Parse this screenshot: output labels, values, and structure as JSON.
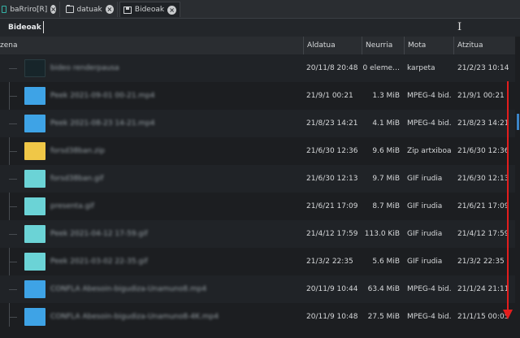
{
  "tabs": [
    {
      "label": "baRriro[R]",
      "icon": "teal-folder-icon"
    },
    {
      "label": "datuak",
      "icon": "folder-icon"
    },
    {
      "label": "Bideoak",
      "icon": "save-icon",
      "active": true
    }
  ],
  "location": {
    "crumb": "Bideoak"
  },
  "columns": {
    "name": "zena",
    "modified": "Aldatua",
    "size": "Neurria",
    "type": "Mota",
    "accessed": "Atzitua"
  },
  "files": [
    {
      "name": "bideo renderpausa",
      "thumb": "folder",
      "modified": "20/11/8 20:48",
      "size": "0 eleme…",
      "type": "karpeta",
      "accessed": "21/2/23 10:14"
    },
    {
      "name": "Peek 2021-09-01 00-21.mp4",
      "thumb": "video",
      "modified": "21/9/1 00:21",
      "size": "1.3 MiB",
      "type": "MPEG-4 bid…",
      "accessed": "21/9/1 00:21"
    },
    {
      "name": "Peek 2021-08-23 14-21.mp4",
      "thumb": "video",
      "modified": "21/8/23 14:21",
      "size": "4.1 MiB",
      "type": "MPEG-4 bid…",
      "accessed": "21/8/23 14:21"
    },
    {
      "name": "forsd38ban.zip",
      "thumb": "zip",
      "modified": "21/6/30 12:36",
      "size": "9.6 MiB",
      "type": "Zip artxiboa",
      "accessed": "21/6/30 12:36"
    },
    {
      "name": "forsd38ban.gif",
      "thumb": "gif",
      "modified": "21/6/30 12:13",
      "size": "9.7 MiB",
      "type": "GIF irudia",
      "accessed": "21/6/30 12:13"
    },
    {
      "name": "presenta.gif",
      "thumb": "gif",
      "modified": "21/6/21 17:09",
      "size": "8.7 MiB",
      "type": "GIF irudia",
      "accessed": "21/6/21 17:09"
    },
    {
      "name": "Peek 2021-04-12 17-59.gif",
      "thumb": "gif",
      "modified": "21/4/12 17:59",
      "size": "113.0 KiB",
      "type": "GIF irudia",
      "accessed": "21/4/12 17:59"
    },
    {
      "name": "Peek 2021-03-02 22-35.gif",
      "thumb": "gif",
      "modified": "21/3/2 22:35",
      "size": "5.6 MiB",
      "type": "GIF irudia",
      "accessed": "21/3/2 22:35"
    },
    {
      "name": "CONFLA Abesoin-bigudiza-Unamuno8.mp4",
      "thumb": "video",
      "modified": "20/11/9 10:44",
      "size": "63.4 MiB",
      "type": "MPEG-4 bid…",
      "accessed": "21/1/24 21:11"
    },
    {
      "name": "CONFLA Abesoin-bigudiza-Unamuno8-4K.mp4",
      "thumb": "video",
      "modified": "20/11/9 10:48",
      "size": "27.5 MiB",
      "type": "MPEG-4 bid…",
      "accessed": "21/1/15 00:05"
    }
  ],
  "colors": {
    "annotation": "#e21d1d",
    "folder_accent": "#35b3a7",
    "selection": "#3b84c8"
  }
}
